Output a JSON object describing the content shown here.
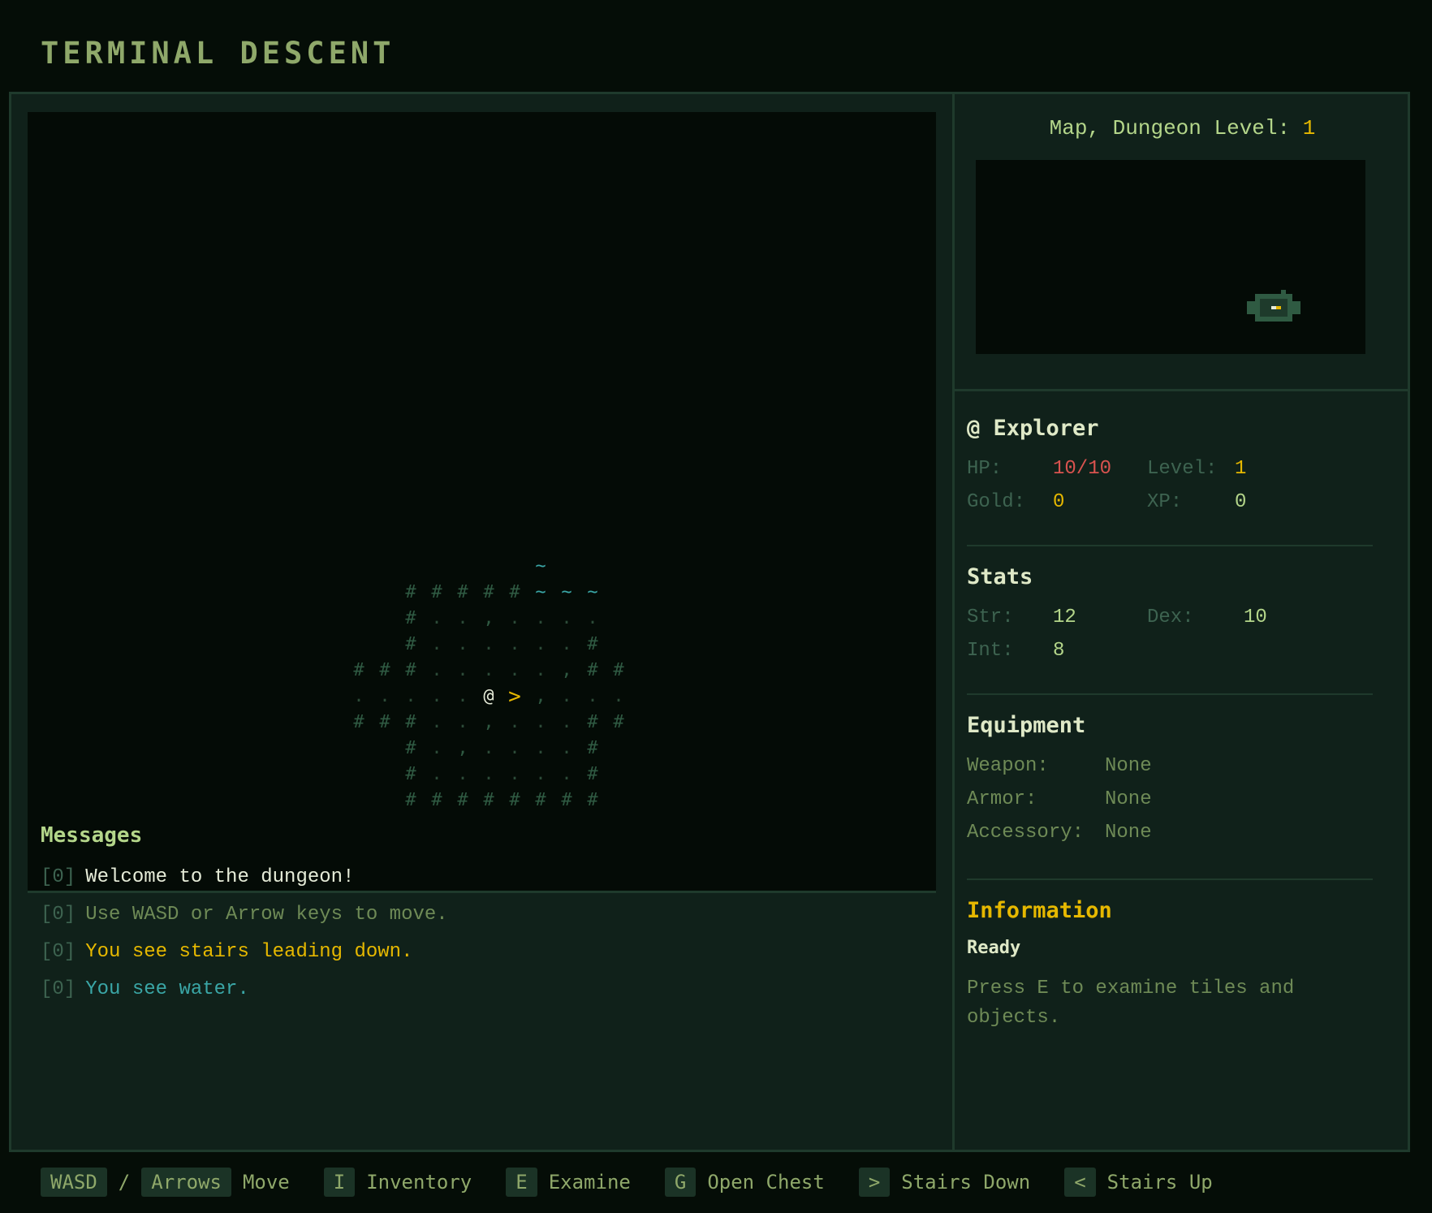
{
  "app_title": "TERMINAL DESCENT",
  "map_tiles": [
    {
      "ch": "~",
      "col": 7,
      "row": 0,
      "kind": "water"
    },
    {
      "ch": "#",
      "col": 2,
      "row": 1,
      "kind": "wall"
    },
    {
      "ch": "#",
      "col": 3,
      "row": 1,
      "kind": "wall"
    },
    {
      "ch": "#",
      "col": 4,
      "row": 1,
      "kind": "wall"
    },
    {
      "ch": "#",
      "col": 5,
      "row": 1,
      "kind": "wall"
    },
    {
      "ch": "#",
      "col": 6,
      "row": 1,
      "kind": "wall"
    },
    {
      "ch": "~",
      "col": 7,
      "row": 1,
      "kind": "water"
    },
    {
      "ch": "~",
      "col": 8,
      "row": 1,
      "kind": "water"
    },
    {
      "ch": "~",
      "col": 9,
      "row": 1,
      "kind": "water"
    },
    {
      "ch": "#",
      "col": 2,
      "row": 2,
      "kind": "wall"
    },
    {
      "ch": ".",
      "col": 3,
      "row": 2,
      "kind": "floor"
    },
    {
      "ch": ".",
      "col": 4,
      "row": 2,
      "kind": "floor"
    },
    {
      "ch": ",",
      "col": 5,
      "row": 2,
      "kind": "grass"
    },
    {
      "ch": ".",
      "col": 6,
      "row": 2,
      "kind": "floor"
    },
    {
      "ch": ".",
      "col": 7,
      "row": 2,
      "kind": "floor"
    },
    {
      "ch": ".",
      "col": 8,
      "row": 2,
      "kind": "floor"
    },
    {
      "ch": ".",
      "col": 9,
      "row": 2,
      "kind": "floor"
    },
    {
      "ch": "#",
      "col": 2,
      "row": 3,
      "kind": "wall"
    },
    {
      "ch": ".",
      "col": 3,
      "row": 3,
      "kind": "floor"
    },
    {
      "ch": ".",
      "col": 4,
      "row": 3,
      "kind": "floor"
    },
    {
      "ch": ".",
      "col": 5,
      "row": 3,
      "kind": "floor"
    },
    {
      "ch": ".",
      "col": 6,
      "row": 3,
      "kind": "floor"
    },
    {
      "ch": ".",
      "col": 7,
      "row": 3,
      "kind": "floor"
    },
    {
      "ch": ".",
      "col": 8,
      "row": 3,
      "kind": "floor"
    },
    {
      "ch": "#",
      "col": 9,
      "row": 3,
      "kind": "wall"
    },
    {
      "ch": "#",
      "col": 0,
      "row": 4,
      "kind": "wall"
    },
    {
      "ch": "#",
      "col": 1,
      "row": 4,
      "kind": "wall"
    },
    {
      "ch": "#",
      "col": 2,
      "row": 4,
      "kind": "wall"
    },
    {
      "ch": ".",
      "col": 3,
      "row": 4,
      "kind": "floor"
    },
    {
      "ch": ".",
      "col": 4,
      "row": 4,
      "kind": "floor"
    },
    {
      "ch": ".",
      "col": 5,
      "row": 4,
      "kind": "floor"
    },
    {
      "ch": ".",
      "col": 6,
      "row": 4,
      "kind": "floor"
    },
    {
      "ch": ".",
      "col": 7,
      "row": 4,
      "kind": "floor"
    },
    {
      "ch": ",",
      "col": 8,
      "row": 4,
      "kind": "grass"
    },
    {
      "ch": "#",
      "col": 9,
      "row": 4,
      "kind": "wall"
    },
    {
      "ch": "#",
      "col": 10,
      "row": 4,
      "kind": "wall"
    },
    {
      "ch": ".",
      "col": 0,
      "row": 5,
      "kind": "floor"
    },
    {
      "ch": ".",
      "col": 1,
      "row": 5,
      "kind": "floor"
    },
    {
      "ch": ".",
      "col": 2,
      "row": 5,
      "kind": "floor"
    },
    {
      "ch": ".",
      "col": 3,
      "row": 5,
      "kind": "floor"
    },
    {
      "ch": ".",
      "col": 4,
      "row": 5,
      "kind": "floor"
    },
    {
      "ch": "@",
      "col": 5,
      "row": 5,
      "kind": "player"
    },
    {
      "ch": ">",
      "col": 6,
      "row": 5,
      "kind": "stairs"
    },
    {
      "ch": ",",
      "col": 7,
      "row": 5,
      "kind": "grass"
    },
    {
      "ch": ".",
      "col": 8,
      "row": 5,
      "kind": "floor"
    },
    {
      "ch": ".",
      "col": 9,
      "row": 5,
      "kind": "floor"
    },
    {
      "ch": ".",
      "col": 10,
      "row": 5,
      "kind": "floor"
    },
    {
      "ch": "#",
      "col": 0,
      "row": 6,
      "kind": "wall"
    },
    {
      "ch": "#",
      "col": 1,
      "row": 6,
      "kind": "wall"
    },
    {
      "ch": "#",
      "col": 2,
      "row": 6,
      "kind": "wall"
    },
    {
      "ch": ".",
      "col": 3,
      "row": 6,
      "kind": "floor"
    },
    {
      "ch": ".",
      "col": 4,
      "row": 6,
      "kind": "floor"
    },
    {
      "ch": ",",
      "col": 5,
      "row": 6,
      "kind": "grass"
    },
    {
      "ch": ".",
      "col": 6,
      "row": 6,
      "kind": "floor"
    },
    {
      "ch": ".",
      "col": 7,
      "row": 6,
      "kind": "floor"
    },
    {
      "ch": ".",
      "col": 8,
      "row": 6,
      "kind": "floor"
    },
    {
      "ch": "#",
      "col": 9,
      "row": 6,
      "kind": "wall"
    },
    {
      "ch": "#",
      "col": 10,
      "row": 6,
      "kind": "wall"
    },
    {
      "ch": "#",
      "col": 2,
      "row": 7,
      "kind": "wall"
    },
    {
      "ch": ".",
      "col": 3,
      "row": 7,
      "kind": "floor"
    },
    {
      "ch": ",",
      "col": 4,
      "row": 7,
      "kind": "grass"
    },
    {
      "ch": ".",
      "col": 5,
      "row": 7,
      "kind": "floor"
    },
    {
      "ch": ".",
      "col": 6,
      "row": 7,
      "kind": "floor"
    },
    {
      "ch": ".",
      "col": 7,
      "row": 7,
      "kind": "floor"
    },
    {
      "ch": ".",
      "col": 8,
      "row": 7,
      "kind": "floor"
    },
    {
      "ch": "#",
      "col": 9,
      "row": 7,
      "kind": "wall"
    },
    {
      "ch": "#",
      "col": 2,
      "row": 8,
      "kind": "wall"
    },
    {
      "ch": ".",
      "col": 3,
      "row": 8,
      "kind": "floor"
    },
    {
      "ch": ".",
      "col": 4,
      "row": 8,
      "kind": "floor"
    },
    {
      "ch": ".",
      "col": 5,
      "row": 8,
      "kind": "floor"
    },
    {
      "ch": ".",
      "col": 6,
      "row": 8,
      "kind": "floor"
    },
    {
      "ch": ".",
      "col": 7,
      "row": 8,
      "kind": "floor"
    },
    {
      "ch": ".",
      "col": 8,
      "row": 8,
      "kind": "floor"
    },
    {
      "ch": "#",
      "col": 9,
      "row": 8,
      "kind": "wall"
    },
    {
      "ch": "#",
      "col": 2,
      "row": 9,
      "kind": "wall"
    },
    {
      "ch": "#",
      "col": 3,
      "row": 9,
      "kind": "wall"
    },
    {
      "ch": "#",
      "col": 4,
      "row": 9,
      "kind": "wall"
    },
    {
      "ch": "#",
      "col": 5,
      "row": 9,
      "kind": "wall"
    },
    {
      "ch": "#",
      "col": 6,
      "row": 9,
      "kind": "wall"
    },
    {
      "ch": "#",
      "col": 7,
      "row": 9,
      "kind": "wall"
    },
    {
      "ch": "#",
      "col": 8,
      "row": 9,
      "kind": "wall"
    },
    {
      "ch": "#",
      "col": 9,
      "row": 9,
      "kind": "wall"
    }
  ],
  "messages": {
    "title": "Messages",
    "lines": [
      {
        "idx": "[0]",
        "text": "Welcome to the dungeon!",
        "color": "#e6ecd8"
      },
      {
        "idx": "[0]",
        "text": "Use WASD or Arrow keys to move.",
        "color": "#6e8a56"
      },
      {
        "idx": "[0]",
        "text": "You see stairs leading down.",
        "color": "#e6b800"
      },
      {
        "idx": "[0]",
        "text": "You see water.",
        "color": "#3aa6a6"
      }
    ]
  },
  "minimap": {
    "title_prefix": "Map, Dungeon Level:",
    "level": "1"
  },
  "player": {
    "name": "@ Explorer",
    "hp_label": "HP:",
    "hp_value": "10/10",
    "level_label": "Level:",
    "level_value": "1",
    "gold_label": "Gold:",
    "gold_value": "0",
    "xp_label": "XP:",
    "xp_value": "0"
  },
  "stats": {
    "title": "Stats",
    "str_label": "Str:",
    "str_value": "12",
    "dex_label": "Dex:",
    "dex_value": "10",
    "int_label": "Int:",
    "int_value": "8"
  },
  "equipment": {
    "title": "Equipment",
    "weapon_label": "Weapon:",
    "weapon_value": "None",
    "armor_label": "Armor:",
    "armor_value": "None",
    "accessory_label": "Accessory:",
    "accessory_value": "None"
  },
  "information": {
    "title": "Information",
    "status": "Ready",
    "text": "Press E to examine tiles and objects."
  },
  "controls": [
    {
      "keys": [
        "WASD",
        "Arrows"
      ],
      "sep": "/",
      "label": "Move"
    },
    {
      "keys": [
        "I"
      ],
      "label": "Inventory"
    },
    {
      "keys": [
        "E"
      ],
      "label": "Examine"
    },
    {
      "keys": [
        "G"
      ],
      "label": "Open Chest"
    },
    {
      "keys": [
        ">"
      ],
      "label": "Stairs Down"
    },
    {
      "keys": [
        "<"
      ],
      "label": "Stairs Up"
    }
  ],
  "colors": {
    "background": "#050d07",
    "panel": "#10211a",
    "border": "#1f3a2c",
    "accent_gold": "#e6b800",
    "hp_red": "#d9534f",
    "water_cyan": "#3aa6a6",
    "text_green": "#8fa86a"
  }
}
